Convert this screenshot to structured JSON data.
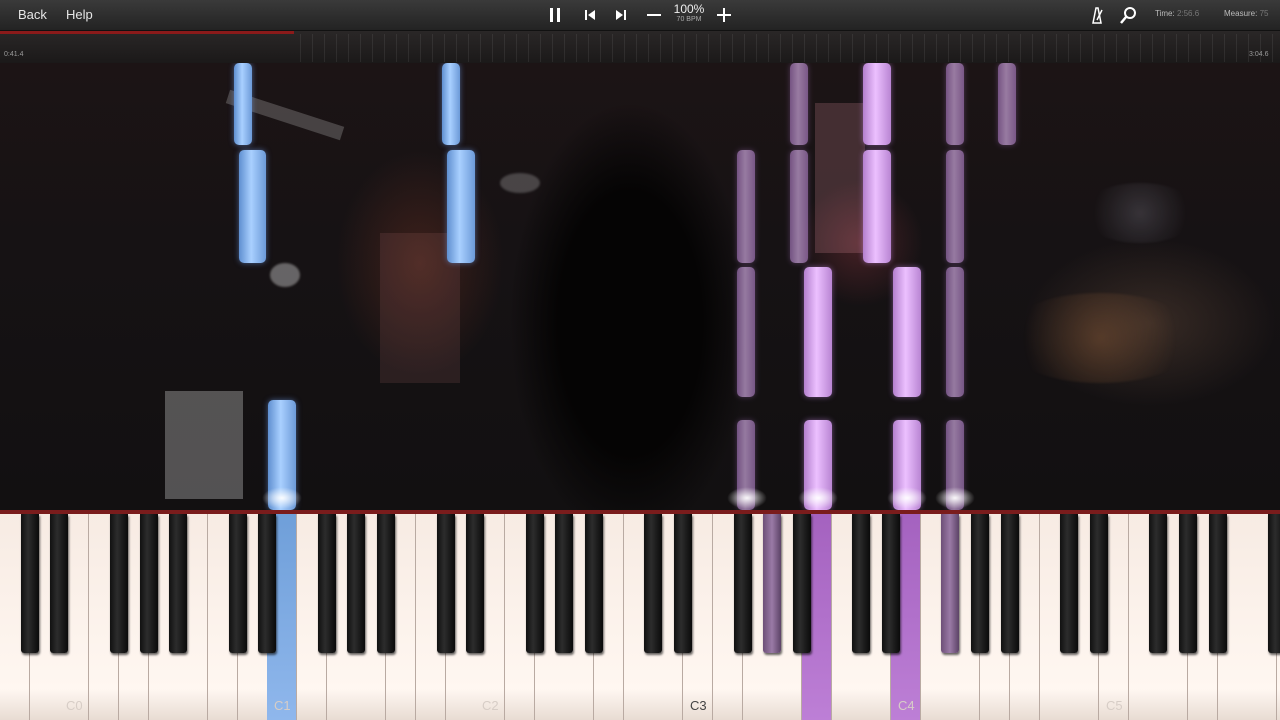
{
  "toolbar": {
    "back_label": "Back",
    "help_label": "Help",
    "zoom": "100%",
    "bpm": "70 BPM",
    "time_label": "Time:",
    "time_value": "2:56.6",
    "measure_label": "Measure:",
    "measure_value": "75",
    "icons": [
      "pause-icon",
      "skip-back-icon",
      "skip-forward-icon",
      "minus-icon",
      "plus-icon",
      "metronome-icon",
      "search-icon"
    ]
  },
  "timeline": {
    "elapsed": "0:41.4",
    "total": "3:04.6",
    "progress": 0.23
  },
  "keyboard": {
    "octave_labels": [
      "C0",
      "C1",
      "C2",
      "C3",
      "C4",
      "C5"
    ],
    "colors": {
      "left_hand": "#7aa8e6",
      "right_hand": "#d9a0f0",
      "highlight": "#c9a0e6"
    }
  }
}
